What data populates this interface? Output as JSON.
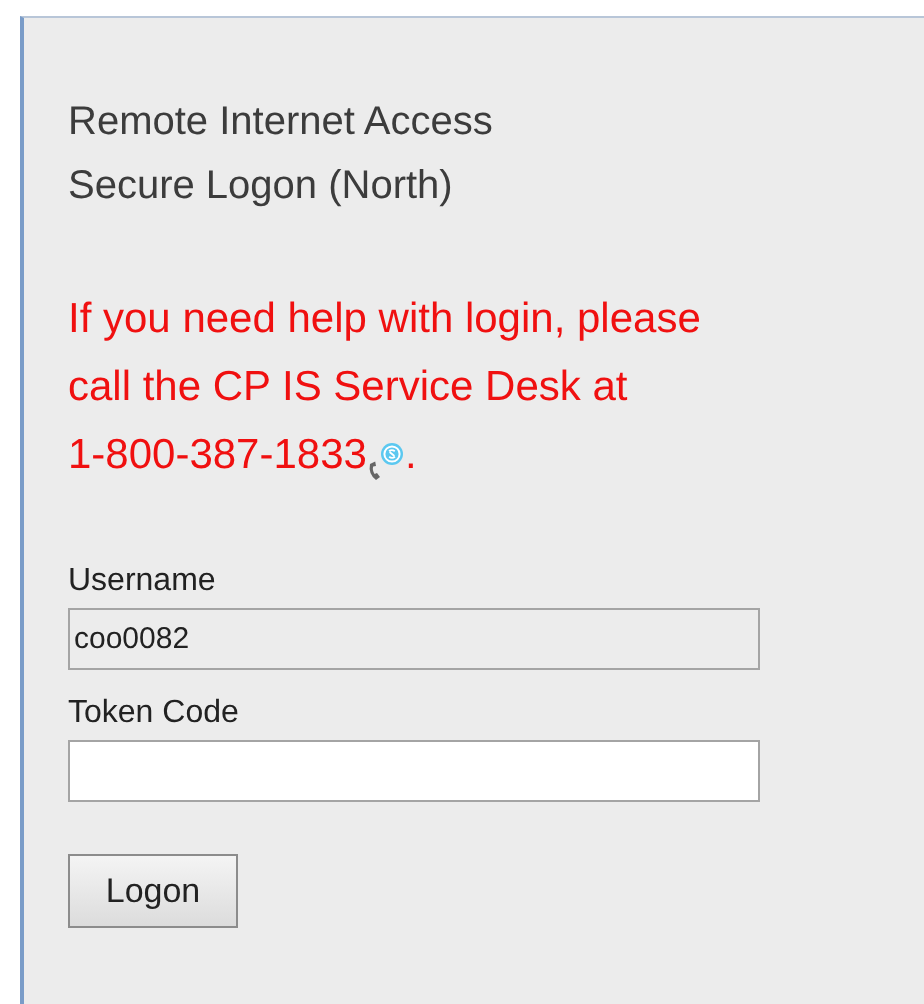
{
  "heading": [
    "Remote Internet Access",
    "Secure Logon (North)"
  ],
  "help": {
    "lines": [
      "If you need help with login, please",
      "call the CP IS Service Desk at",
      "1-800-387-1833"
    ],
    "end": "."
  },
  "fields": [
    {
      "label": "Username",
      "value": "coo0082",
      "disabled": true
    },
    {
      "label": "Token Code",
      "disabled": false
    }
  ],
  "button": "Logon"
}
